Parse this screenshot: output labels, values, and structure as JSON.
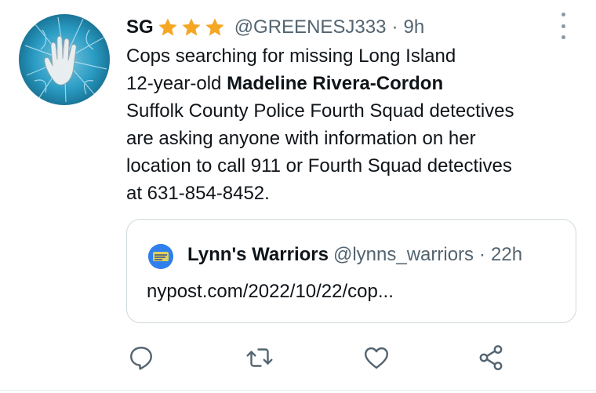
{
  "tweet": {
    "author_name": "SG",
    "handle": "@GREENESJ333",
    "separator": "·",
    "time": "9h",
    "text_lines": {
      "l1": "Cops searching for missing Long Island",
      "l2_prefix": "12-year-old ",
      "l2_bold": "Madeline Rivera-Cordon",
      "l3": "Suffolk County Police Fourth Squad detectives",
      "l4": "are asking anyone with information on her",
      "l5": "location to call 911 or Fourth Squad detectives",
      "l6": "at 631-854-8452."
    },
    "icons": {
      "avatar": "white-hand-avatar",
      "stars": "star-icon",
      "more": "more-vertical-icon"
    }
  },
  "quoted_tweet": {
    "author_name": "Lynn's Warriors",
    "handle": "@lynns_warriors",
    "separator": "·",
    "time": "22h",
    "link_text": "nypost.com/2022/10/22/cop...",
    "avatar_icon": "lynns-warriors-logo"
  },
  "actions": {
    "reply_icon": "reply-icon",
    "retweet_icon": "retweet-icon",
    "like_icon": "like-icon",
    "share_icon": "share-icon"
  },
  "colors": {
    "star": "#f5a623",
    "secondary_text": "#536471",
    "border": "#cfd9de",
    "icon": "#536471",
    "avatar_bg": "#1c7fa6",
    "quote_avatar_bg": "#2f80ed"
  }
}
